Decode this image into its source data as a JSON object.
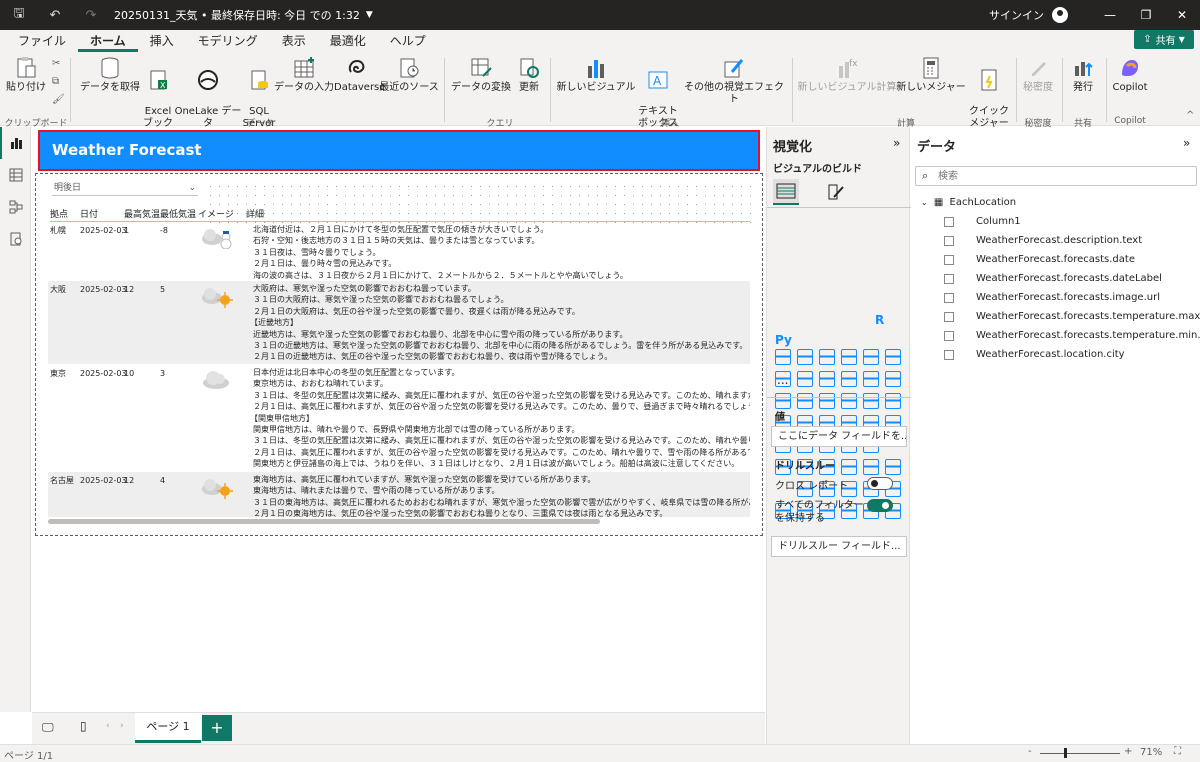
{
  "titlebar": {
    "doc_title": "20250131_天気 • 最終保存日時: 今日 での 1:32",
    "signin": "サインイン"
  },
  "menu": {
    "tabs": [
      "ファイル",
      "ホーム",
      "挿入",
      "モデリング",
      "表示",
      "最適化",
      "ヘルプ"
    ],
    "share": "共有"
  },
  "ribbon": {
    "paste": "貼り付け",
    "get_data": "データを取得",
    "excel": "Excel\nブック",
    "onelake": "OneLake データ\nハブ",
    "sql": "SQL\nServer",
    "enter_data": "データの入力",
    "dataverse": "Dataverse",
    "recent": "最近のソース",
    "transform": "データの変換",
    "refresh": "更新",
    "new_visual": "新しいビジュアル",
    "textbox": "テキスト\nボックス",
    "more_visuals": "その他の視覚エフェクト",
    "new_visual_calc": "新しいビジュアル計算",
    "new_measure": "新しいメジャー",
    "quick_measure": "クイック\nメジャー",
    "sensitivity": "秘密度",
    "publish": "発行",
    "copilot": "Copilot",
    "groups": {
      "clipboard": "クリップボード",
      "data": "データ",
      "query": "クエリ",
      "insert": "挿入",
      "calc": "計算",
      "sensitivity": "秘密度",
      "share": "共有",
      "copilot": "Copilot"
    }
  },
  "report": {
    "title": "Weather Forecast",
    "slicer_value": "明後日",
    "columns": [
      "拠点",
      "日付",
      "最高気温",
      "最低気温",
      "イメージ",
      "詳細"
    ],
    "rows": [
      {
        "city": "札幌",
        "date": "2025-02-03",
        "max": "1",
        "min": "-8",
        "icon": "snow-cloud-icon",
        "detail": [
          "北海道付近は、２月１日にかけて冬型の気圧配置で気圧の傾きが大きいでしょう。",
          "石狩・空知・後志地方の３１日１５時の天気は、曇りまたは雪となっています。",
          "３１日夜は、雪時々曇りでしょう。",
          "２月１日は、曇り時々雪の見込みです。",
          "海の波の高さは、３１日夜から２月１日にかけて、２メートルから２．５メートルとやや高いでしょう。"
        ]
      },
      {
        "city": "大阪",
        "date": "2025-02-03",
        "max": "12",
        "min": "5",
        "icon": "cloud-sun-icon",
        "detail": [
          "大阪府は、寒気や湿った空気の影響でおおむね曇っています。",
          "３１日の大阪府は、寒気や湿った空気の影響でおおむね曇るでしょう。",
          "２月１日の大阪府は、気圧の谷や湿った空気の影響で曇り、夜遅くは雨が降る見込みです。",
          "【近畿地方】",
          "近畿地方は、寒気や湿った空気の影響でおおむね曇り、北部を中心に雪や雨の降っている所があります。",
          "３１日の近畿地方は、寒気や湿った空気の影響でおおむね曇り、北部を中心に雨の降る所があるでしょう。雷を伴う所がある見込みです。",
          "２月１日の近畿地方は、気圧の谷や湿った空気の影響でおおむね曇り、夜は雨や雪が降るでしょう。"
        ]
      },
      {
        "city": "東京",
        "date": "2025-02-03",
        "max": "10",
        "min": "3",
        "icon": "cloud-icon",
        "detail": [
          "日本付近は北日本中心の冬型の気圧配置となっています。",
          "東京地方は、おおむね晴れています。",
          "３１日は、冬型の気圧配置は次第に緩み、高気圧に覆われますが、気圧の谷や湿った空気の影響を受ける見込みです。このため、晴れますが、夜遅",
          "２月１日は、高気圧に覆われますが、気圧の谷や湿った空気の影響を受ける見込みです。このため、曇りで、昼過ぎまで時々晴れるでしょう。",
          "【関東甲信地方】",
          "関東甲信地方は、晴れや曇りで、長野県や関東地方北部では雪の降っている所があります。",
          "３１日は、冬型の気圧配置は次第に緩み、高気圧に覆われますが、気圧の谷や湿った空気の影響を受ける見込みです。このため、晴れや曇りで、長",
          "２月１日は、高気圧に覆われますが、気圧の谷や湿った空気の影響を受ける見込みです。このため、晴れや曇りで、雪や雨の降る所があるでしょう",
          "関東地方と伊豆諸島の海上では、うねりを伴い、３１日はしけとなり、２月１日は波が高いでしょう。船舶は高波に注意してください。"
        ]
      },
      {
        "city": "名古屋",
        "date": "2025-02-03",
        "max": "12",
        "min": "4",
        "icon": "cloud-sun-icon",
        "detail": [
          "東海地方は、高気圧に覆われていますが、寒気や湿った空気の影響を受けている所があります。",
          "東海地方は、晴れまたは曇りで、雪や雨の降っている所があります。",
          "３１日の東海地方は、高気圧に覆われるためおおむね晴れますが、寒気や湿った空気の影響で雲が広がりやすく、岐阜県では雪の降る所があるでし",
          "２月１日の東海地方は、気圧の谷や湿った空気の影響でおおむね曇りとなり、三重県では夜は雨となる見込みです。"
        ]
      }
    ]
  },
  "viz_pane": {
    "title": "視覚化",
    "build": "ビジュアルのビルド",
    "values_label": "値",
    "values_placeholder": "ここにデータ フィールドを...",
    "drillthrough": "ドリルスルー",
    "cross_report": "クロス レポート",
    "keep_filters": "すべてのフィルターを保持する",
    "drill_placeholder": "ドリルスルー フィールド...",
    "more": "...",
    "r_label": "R",
    "py_label": "Py"
  },
  "data_pane": {
    "title": "データ",
    "search_placeholder": "検索",
    "table": "EachLocation",
    "fields": [
      "Column1",
      "WeatherForecast.description.text",
      "WeatherForecast.forecasts.date",
      "WeatherForecast.forecasts.dateLabel",
      "WeatherForecast.forecasts.image.url",
      "WeatherForecast.forecasts.temperature.max.celsius",
      "WeatherForecast.forecasts.temperature.min.celsius",
      "WeatherForecast.location.city"
    ]
  },
  "bottom": {
    "page_tab": "ページ 1",
    "add": "+"
  },
  "status": {
    "page": "ページ 1/1",
    "zoom": "71%",
    "zoom_minus": "-",
    "zoom_plus": "+"
  },
  "colors": {
    "accent": "#117865",
    "title_bg": "#118dff",
    "title_border": "#e81123"
  }
}
